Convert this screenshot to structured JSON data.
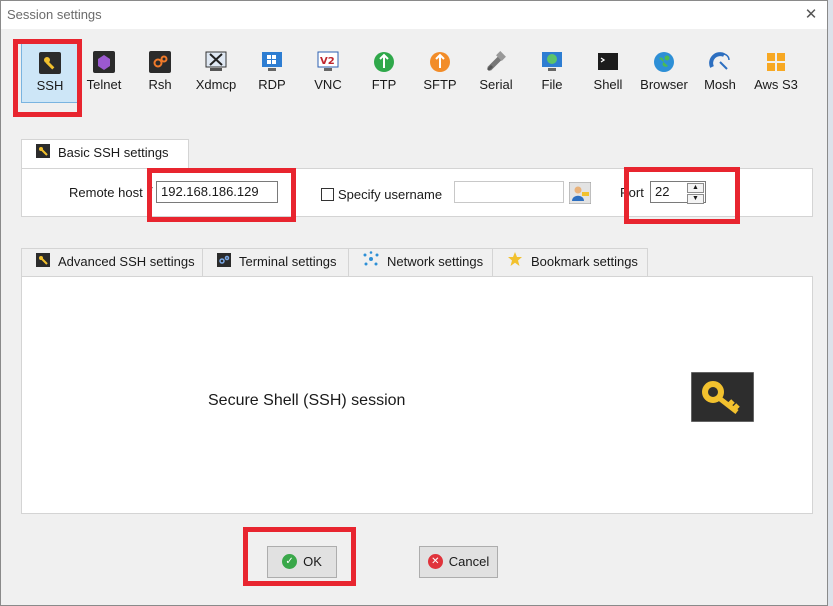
{
  "window": {
    "title": "Session settings",
    "close_glyph": "✕"
  },
  "session_types": [
    {
      "label": "SSH",
      "icon": "ssh-key-icon"
    },
    {
      "label": "Telnet",
      "icon": "telnet-icon"
    },
    {
      "label": "Rsh",
      "icon": "rsh-icon"
    },
    {
      "label": "Xdmcp",
      "icon": "xdmcp-icon"
    },
    {
      "label": "RDP",
      "icon": "rdp-icon"
    },
    {
      "label": "VNC",
      "icon": "vnc-icon"
    },
    {
      "label": "FTP",
      "icon": "ftp-icon"
    },
    {
      "label": "SFTP",
      "icon": "sftp-icon"
    },
    {
      "label": "Serial",
      "icon": "serial-icon"
    },
    {
      "label": "File",
      "icon": "file-icon"
    },
    {
      "label": "Shell",
      "icon": "shell-icon"
    },
    {
      "label": "Browser",
      "icon": "browser-icon"
    },
    {
      "label": "Mosh",
      "icon": "mosh-icon"
    },
    {
      "label": "Aws S3",
      "icon": "aws-s3-icon"
    }
  ],
  "basic": {
    "tab_label": "Basic SSH settings",
    "remote_host_label": "Remote host",
    "required_mark": "*",
    "remote_host_value": "192.168.186.129",
    "specify_username_label": "Specify username",
    "username_value": "",
    "port_label": "Port",
    "port_value": "22"
  },
  "lower_tabs": [
    {
      "label": "Advanced SSH settings",
      "icon": "wrench-icon"
    },
    {
      "label": "Terminal settings",
      "icon": "terminal-icon"
    },
    {
      "label": "Network settings",
      "icon": "network-icon"
    },
    {
      "label": "Bookmark settings",
      "icon": "star-icon"
    }
  ],
  "description": "Secure Shell (SSH) session",
  "buttons": {
    "ok": "OK",
    "cancel": "Cancel"
  },
  "colors": {
    "highlight": "#e8252f",
    "selected_bg": "#cde6f7",
    "ok_green": "#3aa84a",
    "cancel_red": "#e0333b"
  }
}
